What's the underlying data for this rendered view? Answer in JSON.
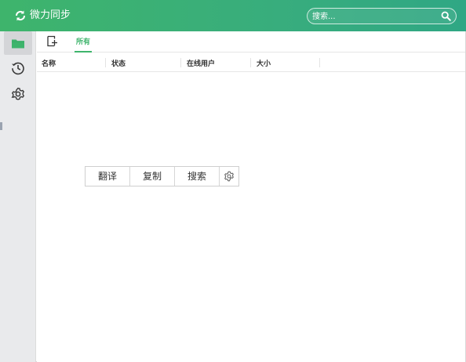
{
  "app": {
    "title": "微力同步"
  },
  "search": {
    "placeholder": "搜索..."
  },
  "tabs": {
    "all_label": "所有"
  },
  "columns": [
    "名称",
    "状态",
    "在线用户",
    "大小"
  ],
  "float_toolbar": {
    "translate": "翻译",
    "copy": "复制",
    "search": "搜索"
  },
  "colors": {
    "brand_green": "#3eb46c",
    "sidebar_bg": "#e9eaec"
  },
  "icons": {
    "logo": "sync-icon",
    "sidebar": [
      "folder-icon",
      "history-icon",
      "settings-icon"
    ],
    "toolbar": "add-folder-icon",
    "float_settings": "gear-icon"
  }
}
